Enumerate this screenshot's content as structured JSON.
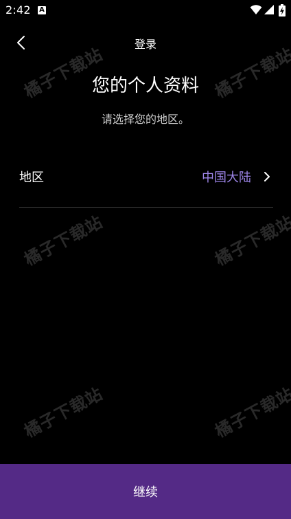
{
  "status_bar": {
    "time": "2:42",
    "app_icon_letter": "A"
  },
  "header": {
    "title": "登录"
  },
  "main": {
    "title": "您的个人资料",
    "subtitle": "请选择您的地区。",
    "region": {
      "label": "地区",
      "value": "中国大陆"
    }
  },
  "footer": {
    "continue_label": "继续"
  },
  "watermark": {
    "text": "橘子下载站"
  },
  "colors": {
    "background": "#000000",
    "accent_text": "#9c84e6",
    "button_bg": "#542a86"
  },
  "icons": [
    "back-arrow-icon",
    "chevron-right-icon",
    "wifi-icon",
    "signal-icon",
    "battery-icon"
  ]
}
